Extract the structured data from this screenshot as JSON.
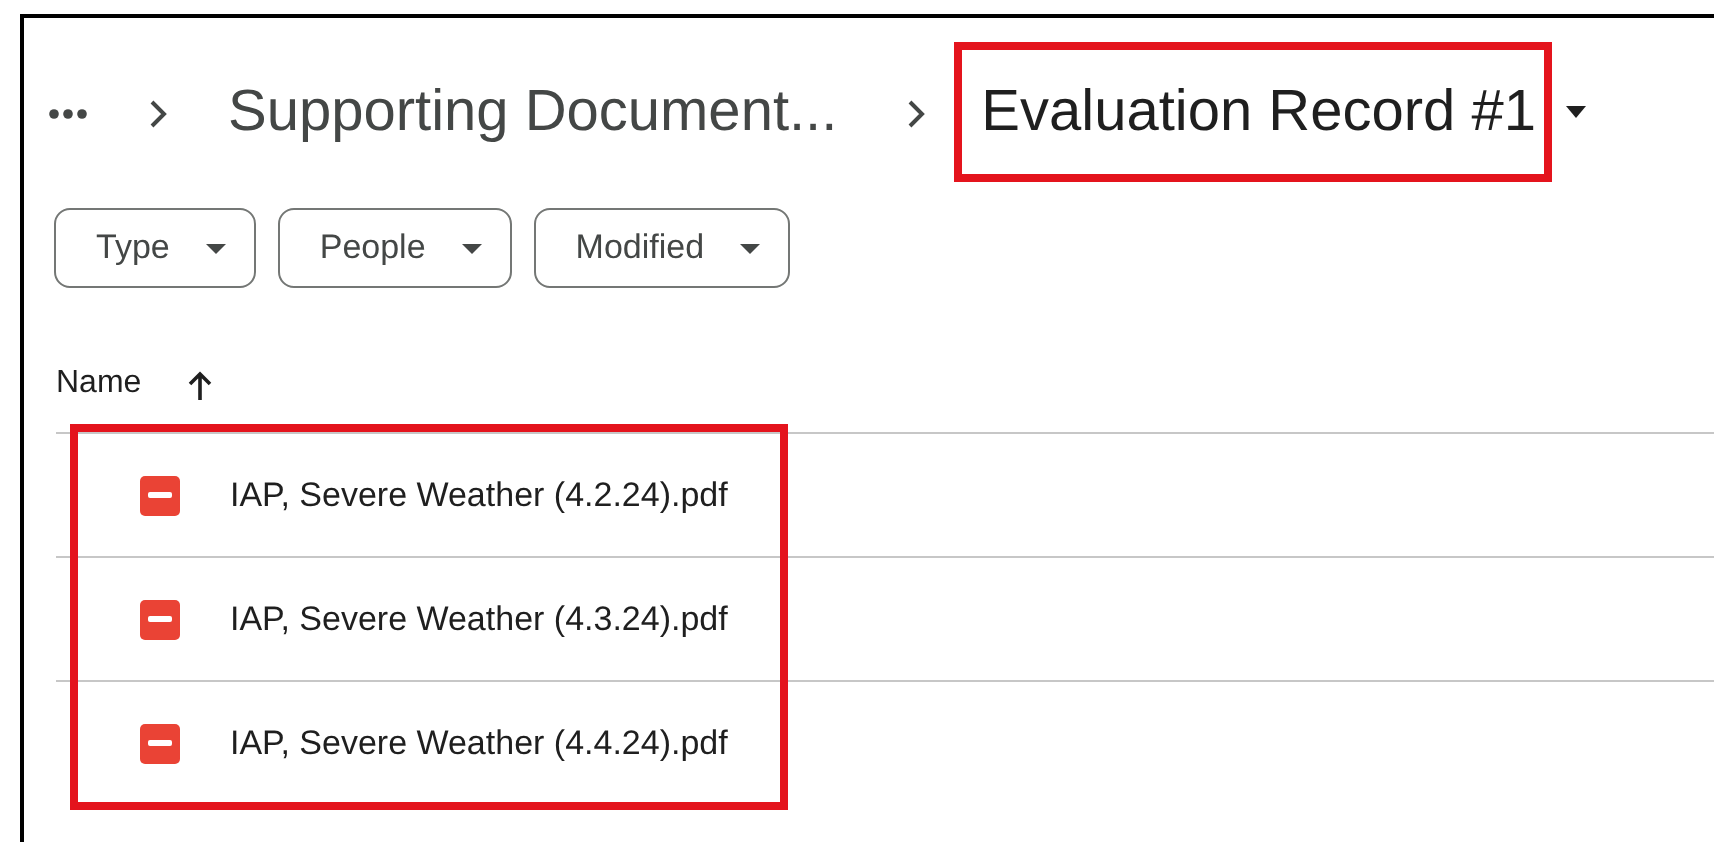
{
  "breadcrumb": {
    "items": [
      {
        "kind": "more"
      },
      {
        "kind": "folder",
        "label": "Supporting Document..."
      },
      {
        "kind": "current",
        "label": "Evaluation Record #1",
        "highlighted": true
      }
    ]
  },
  "filters": [
    {
      "label": "Type"
    },
    {
      "label": "People"
    },
    {
      "label": "Modified"
    }
  ],
  "table": {
    "columns": [
      {
        "label": "Name",
        "sort_ascending": true
      }
    ],
    "rows_highlighted": true,
    "rows": [
      {
        "kind": "pdf",
        "name": "IAP, Severe Weather (4.2.24).pdf"
      },
      {
        "kind": "pdf",
        "name": "IAP, Severe Weather (4.3.24).pdf"
      },
      {
        "kind": "pdf",
        "name": "IAP, Severe Weather (4.4.24).pdf"
      }
    ]
  }
}
